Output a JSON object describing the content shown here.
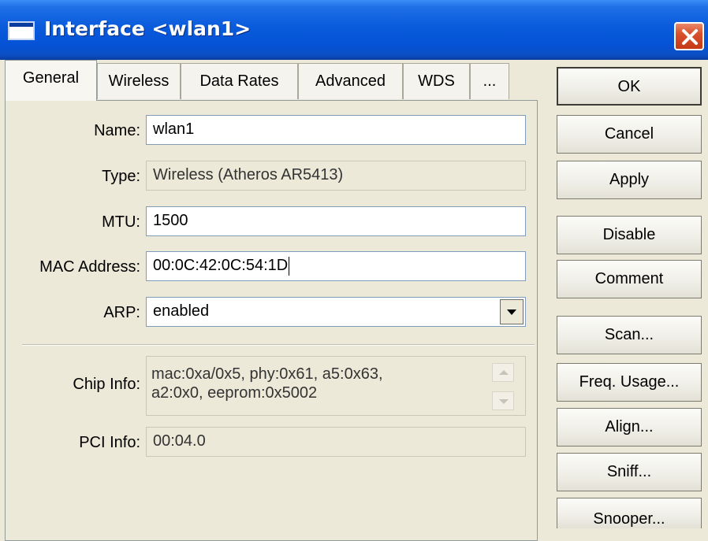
{
  "window": {
    "title": "Interface <wlan1>"
  },
  "tabs": [
    "General",
    "Wireless",
    "Data Rates",
    "Advanced",
    "WDS",
    "..."
  ],
  "form": {
    "name_label": "Name:",
    "name_value": "wlan1",
    "type_label": "Type:",
    "type_value": "Wireless (Atheros AR5413)",
    "mtu_label": "MTU:",
    "mtu_value": "1500",
    "mac_label": "MAC Address:",
    "mac_value": "00:0C:42:0C:54:1D",
    "arp_label": "ARP:",
    "arp_value": "enabled",
    "chip_label": "Chip Info:",
    "chip_line1": "mac:0xa/0x5, phy:0x61, a5:0x63,",
    "chip_line2": "a2:0x0, eeprom:0x5002",
    "pci_label": "PCI Info:",
    "pci_value": "00:04.0"
  },
  "buttons": {
    "ok": "OK",
    "cancel": "Cancel",
    "apply": "Apply",
    "disable": "Disable",
    "comment": "Comment",
    "scan": "Scan...",
    "freq": "Freq. Usage...",
    "align": "Align...",
    "sniff": "Sniff...",
    "snooper": "Snooper..."
  },
  "icons": {
    "window": "window-icon",
    "close": "close-icon",
    "dropdown": "dropdown-arrow-icon"
  },
  "colors": {
    "titlebar": "#0552d6",
    "close": "#c63a16",
    "dialog_bg": "#ece9d8"
  }
}
